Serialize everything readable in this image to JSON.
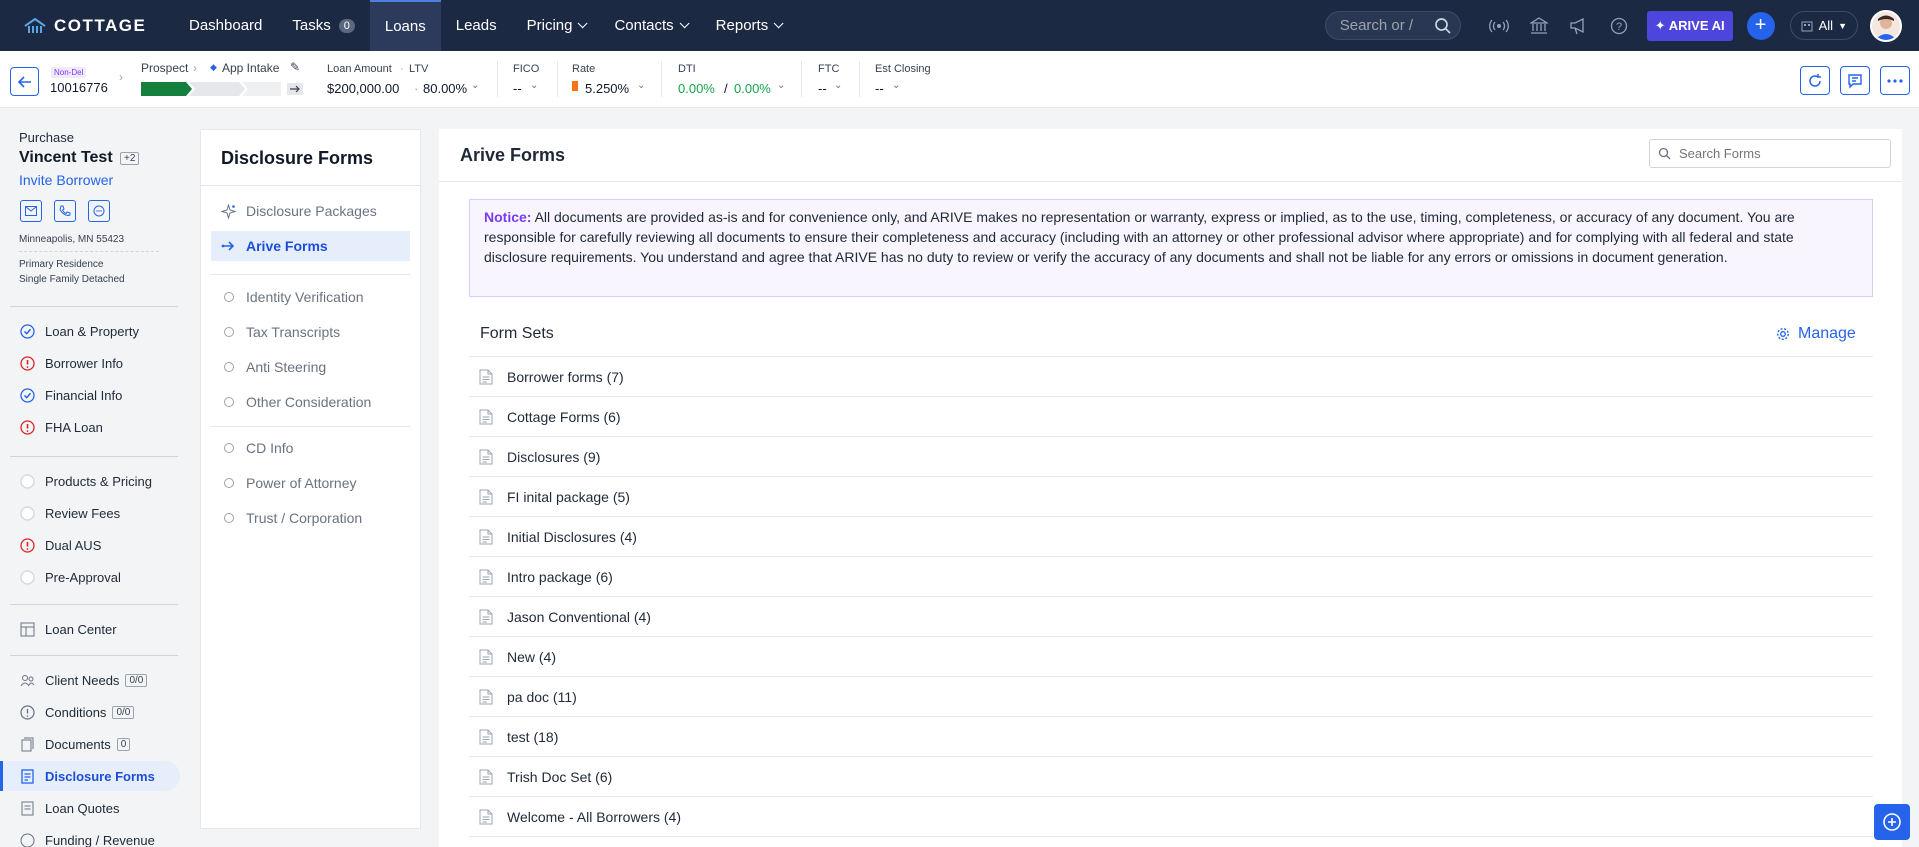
{
  "topnav": {
    "brand": "COTTAGE",
    "items": [
      {
        "label": "Dashboard"
      },
      {
        "label": "Tasks",
        "badge": "0"
      },
      {
        "label": "Loans"
      },
      {
        "label": "Leads"
      },
      {
        "label": "Pricing"
      },
      {
        "label": "Contacts"
      },
      {
        "label": "Reports"
      }
    ],
    "search_placeholder": "Search or /",
    "arive_ai": "ARIVE AI",
    "all_label": "All"
  },
  "loan_header": {
    "tag": "Non-Del",
    "loan_number": "10016776",
    "stage": "Prospect",
    "substage": "App Intake",
    "loan_amount_label": "Loan Amount",
    "ltv_label": "LTV",
    "loan_amount": "$200,000.00",
    "ltv": "80.00%",
    "fico_label": "FICO",
    "fico": "--",
    "rate_label": "Rate",
    "rate": "5.250%",
    "dti_label": "DTI",
    "dti_front": "0.00%",
    "dti_sep": "/",
    "dti_back": "0.00%",
    "ftc_label": "FTC",
    "ftc": "--",
    "closing_label": "Est Closing",
    "closing": "--"
  },
  "borrower": {
    "purpose": "Purchase",
    "name": "Vincent Test",
    "extra_count": "+2",
    "invite": "Invite Borrower",
    "location": "Minneapolis, MN 55423",
    "occupancy": "Primary Residence",
    "property_type": "Single Family Detached"
  },
  "sidebar": {
    "group1": [
      {
        "label": "Loan & Property",
        "status": "done"
      },
      {
        "label": "Borrower Info",
        "status": "error"
      },
      {
        "label": "Financial Info",
        "status": "done"
      },
      {
        "label": "FHA Loan",
        "status": "error"
      }
    ],
    "group2": [
      {
        "label": "Products & Pricing",
        "status": "empty"
      },
      {
        "label": "Review Fees",
        "status": "empty"
      },
      {
        "label": "Dual AUS",
        "status": "error"
      },
      {
        "label": "Pre-Approval",
        "status": "empty"
      }
    ],
    "loan_center": "Loan Center",
    "group3": [
      {
        "label": "Client Needs",
        "badge": "0/0"
      },
      {
        "label": "Conditions",
        "badge": "0/0"
      },
      {
        "label": "Documents",
        "badge": "0"
      },
      {
        "label": "Disclosure Forms",
        "badge": ""
      },
      {
        "label": "Loan Quotes",
        "badge": ""
      },
      {
        "label": "Funding / Revenue",
        "badge": ""
      }
    ]
  },
  "disclosure_panel": {
    "title": "Disclosure Forms",
    "items": [
      {
        "label": "Disclosure Packages"
      },
      {
        "label": "Arive Forms"
      }
    ],
    "sub_items_a": [
      {
        "label": "Identity Verification"
      },
      {
        "label": "Tax Transcripts"
      },
      {
        "label": "Anti Steering"
      },
      {
        "label": "Other Consideration"
      }
    ],
    "sub_items_b": [
      {
        "label": "CD Info"
      },
      {
        "label": "Power of Attorney"
      },
      {
        "label": "Trust / Corporation"
      }
    ]
  },
  "main": {
    "title": "Arive Forms",
    "search_placeholder": "Search Forms",
    "notice_label": "Notice:",
    "notice_text": " All documents are provided as-is and for convenience only, and ARIVE makes no representation or warranty, express or implied, as to the use, timing, completeness, or accuracy of any document. You are responsible for carefully reviewing all documents to ensure their completeness and accuracy (including with an attorney or other professional advisor where appropriate) and for complying with all federal and state disclosure requirements. You understand and agree that ARIVE has no duty to review or verify the accuracy of any documents and shall not be liable for any errors or omissions in document generation.",
    "form_sets_title": "Form Sets",
    "manage_label": "Manage",
    "form_sets": [
      "Borrower forms (7)",
      "Cottage Forms (6)",
      "Disclosures (9)",
      "FI inital package (5)",
      "Initial Disclosures (4)",
      "Intro package (6)",
      "Jason Conventional (4)",
      "New (4)",
      "pa doc (11)",
      "test (18)",
      "Trish Doc Set (6)",
      "Welcome - All Borrowers (4)"
    ]
  },
  "colors": {
    "nav_bg": "#1c2943",
    "accent": "#2563eb",
    "success": "#16a34a",
    "error": "#dc2626",
    "notice": "#7c3aed"
  }
}
